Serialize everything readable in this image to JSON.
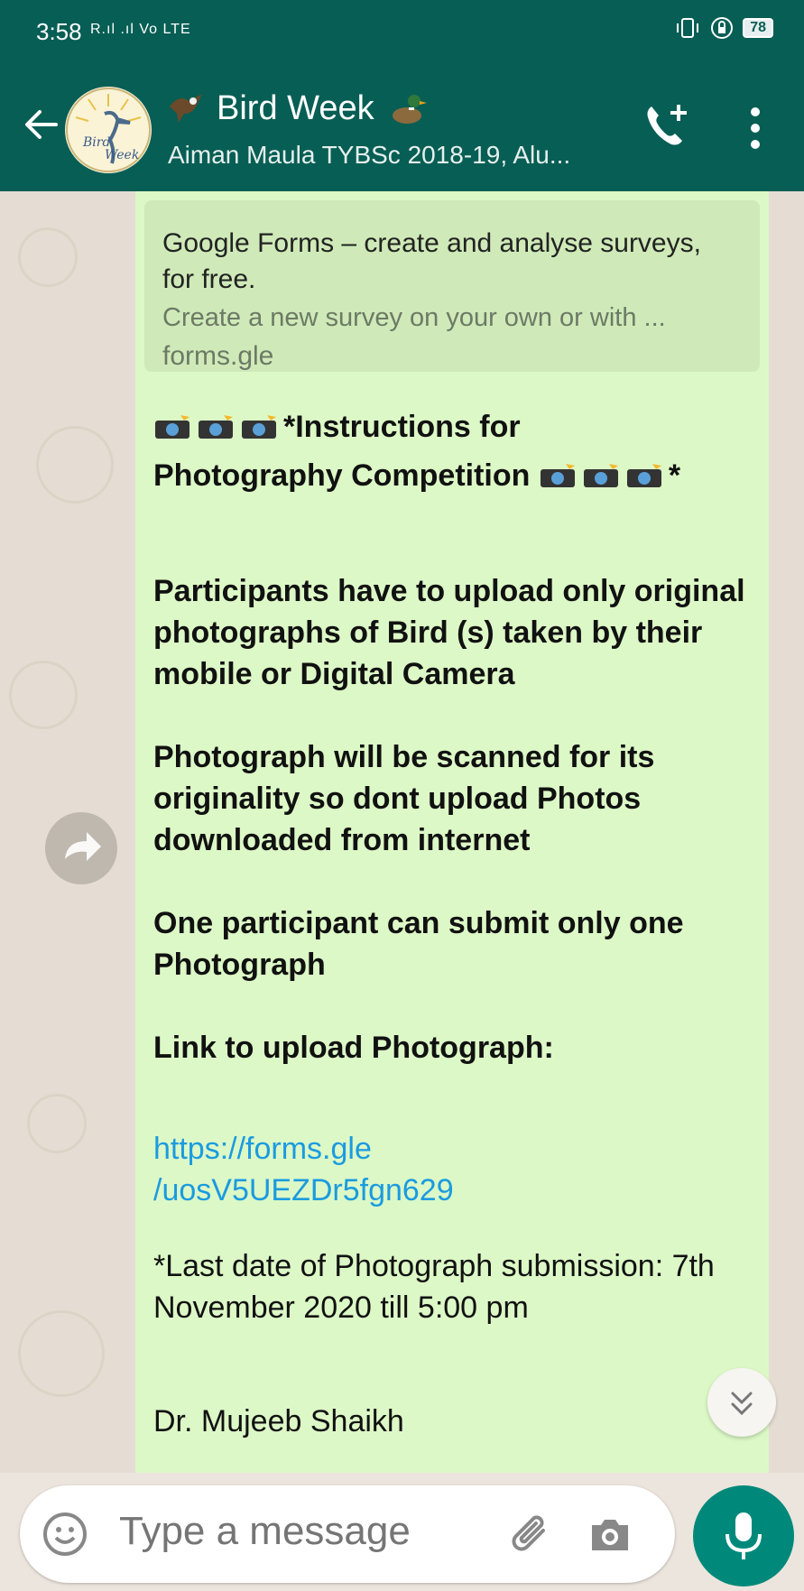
{
  "status_bar": {
    "time": "3:58",
    "signal": "R.ıl .ıl Vo LTE",
    "battery": "78"
  },
  "header": {
    "title": "Bird Week",
    "subtitle": "Aiman Maula TYBSc 2018-19, Alu...",
    "avatar_text": "Bird Week"
  },
  "link_preview": {
    "title": "Google Forms – create and analyse surveys, for free.",
    "description": "Create a new survey on your own or with ...",
    "domain": "forms.gle"
  },
  "message": {
    "heading_line1": "*Instructions for",
    "heading_line2": "Photography Competition",
    "heading_end": "*",
    "para1": "Participants have to upload only original photographs of Bird (s) taken by their mobile or Digital Camera",
    "para2": "Photograph will be scanned for its originality so dont upload Photos downloaded from internet",
    "para3": "One participant can submit only one Photograph",
    "para4": "Link to upload Photograph:",
    "link_line1": "https://forms.gle",
    "link_line2": "/uosV5UEZDr5fgn629",
    "para5": "*Last date of Photograph submission: 7th November 2020 till 5:00 pm",
    "signature": "Dr. Mujeeb Shaikh"
  },
  "input": {
    "placeholder": "Type a message"
  },
  "colors": {
    "header_bg": "#075e54",
    "bubble_bg": "#dcf8c6",
    "link": "#1b9be0",
    "mic_bg": "#00897b"
  }
}
